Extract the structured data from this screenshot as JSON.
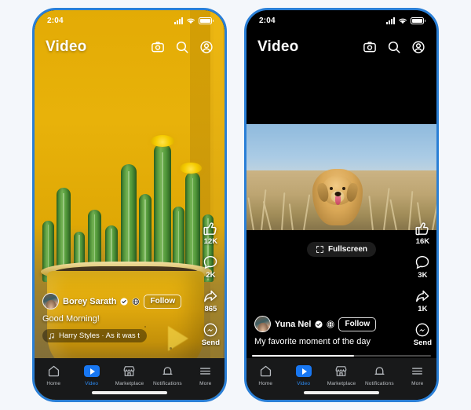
{
  "page": {
    "background_color": "#f4f7fb",
    "frame_color": "#2a7fd6"
  },
  "phones": [
    {
      "id": "left-phone",
      "theme": "photo",
      "status_bar": {
        "time": "2:04",
        "signal_icon": "signal-bars-icon",
        "wifi_icon": "wifi-icon",
        "battery_icon": "battery-icon"
      },
      "app_bar": {
        "title": "Video",
        "actions": [
          {
            "name": "camera-icon",
            "label": "Camera"
          },
          {
            "name": "search-icon",
            "label": "Search"
          },
          {
            "name": "profile-icon",
            "label": "Profile"
          }
        ]
      },
      "media": {
        "type": "photo",
        "subject": "cactus-in-yellow-pot"
      },
      "rail": [
        {
          "icon": "thumbs-up-icon",
          "label": "Like",
          "count": "12K"
        },
        {
          "icon": "comment-bubble-icon",
          "label": "Comment",
          "count": "2K"
        },
        {
          "icon": "share-arrow-icon",
          "label": "Share",
          "count": "865"
        },
        {
          "icon": "messenger-icon",
          "label": "Send",
          "count": "Send"
        }
      ],
      "more_menu": "•••",
      "post": {
        "author": "Borey Sarath",
        "verified_icon": "verified-badge-icon",
        "audience_icon": "globe-icon",
        "follow_label": "Follow",
        "caption": "Good Morning!",
        "music_icon": "music-note-icon",
        "music_label": "Harry Styles · As it was t"
      },
      "bottom_nav": [
        {
          "icon": "home-icon",
          "label": "Home",
          "active": false
        },
        {
          "icon": "video-icon",
          "label": "Video",
          "active": true
        },
        {
          "icon": "marketplace-icon",
          "label": "Marketplace",
          "active": false
        },
        {
          "icon": "bell-icon",
          "label": "Notifications",
          "active": false
        },
        {
          "icon": "menu-icon",
          "label": "More",
          "active": false
        }
      ]
    },
    {
      "id": "right-phone",
      "theme": "dark",
      "status_bar": {
        "time": "2:04",
        "signal_icon": "signal-bars-icon",
        "wifi_icon": "wifi-icon",
        "battery_icon": "battery-icon"
      },
      "app_bar": {
        "title": "Video",
        "actions": [
          {
            "name": "camera-icon",
            "label": "Camera"
          },
          {
            "name": "search-icon",
            "label": "Search"
          },
          {
            "name": "profile-icon",
            "label": "Profile"
          }
        ]
      },
      "media": {
        "type": "video",
        "subject": "golden-retriever-in-field"
      },
      "fullscreen_button": {
        "icon": "fullscreen-icon",
        "label": "Fullscreen"
      },
      "progress": {
        "percent": 57
      },
      "rail": [
        {
          "icon": "thumbs-up-icon",
          "label": "Like",
          "count": "16K"
        },
        {
          "icon": "comment-bubble-icon",
          "label": "Comment",
          "count": "3K"
        },
        {
          "icon": "share-arrow-icon",
          "label": "Share",
          "count": "1K"
        },
        {
          "icon": "messenger-icon",
          "label": "Send",
          "count": "Send"
        }
      ],
      "more_menu": "•••",
      "post": {
        "author": "Yuna Nel",
        "verified_icon": "verified-badge-icon",
        "audience_icon": "globe-icon",
        "follow_label": "Follow",
        "caption": "My favorite moment of the day"
      },
      "bottom_nav": [
        {
          "icon": "home-icon",
          "label": "Home",
          "active": false
        },
        {
          "icon": "video-icon",
          "label": "Video",
          "active": true
        },
        {
          "icon": "marketplace-icon",
          "label": "Marketplace",
          "active": false
        },
        {
          "icon": "bell-icon",
          "label": "Notifications",
          "active": false
        },
        {
          "icon": "menu-icon",
          "label": "More",
          "active": false
        }
      ]
    }
  ]
}
